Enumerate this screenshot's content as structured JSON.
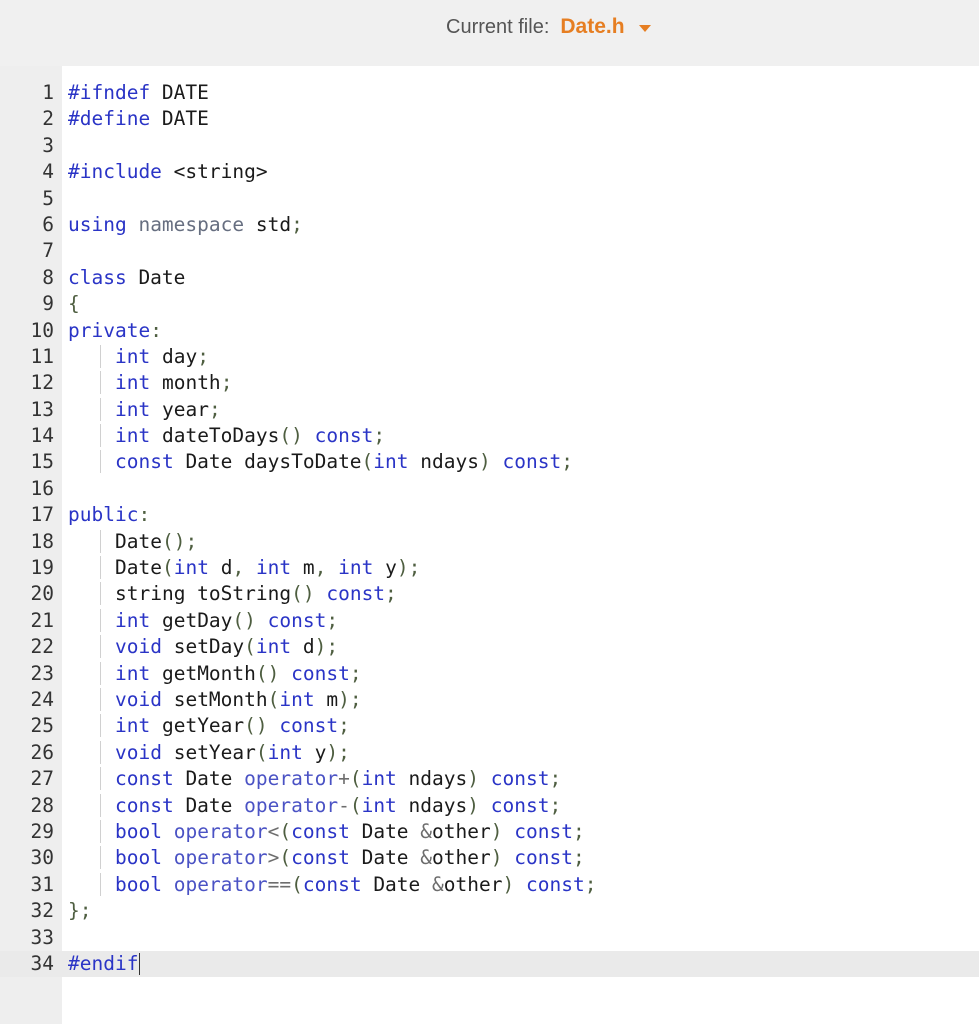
{
  "header": {
    "label": "Current file:",
    "file_name": "Date.h"
  },
  "lines": [
    [
      [
        "pp",
        "#ifndef"
      ],
      [
        "t",
        " DATE"
      ]
    ],
    [
      [
        "pp",
        "#define"
      ],
      [
        "t",
        " DATE"
      ]
    ],
    [],
    [
      [
        "pp",
        "#include"
      ],
      [
        "t",
        " <string>"
      ]
    ],
    [],
    [
      [
        "kw",
        "using"
      ],
      [
        "t",
        " "
      ],
      [
        "ns",
        "namespace"
      ],
      [
        "t",
        " std"
      ],
      [
        "p",
        ";"
      ]
    ],
    [],
    [
      [
        "kw",
        "class"
      ],
      [
        "t",
        " Date"
      ]
    ],
    [
      [
        "p",
        "{"
      ]
    ],
    [
      [
        "kw",
        "private"
      ],
      [
        "p",
        ":"
      ]
    ],
    [
      [
        "in",
        ""
      ],
      [
        "kw",
        "int"
      ],
      [
        "t",
        " day"
      ],
      [
        "p",
        ";"
      ]
    ],
    [
      [
        "in",
        ""
      ],
      [
        "kw",
        "int"
      ],
      [
        "t",
        " month"
      ],
      [
        "p",
        ";"
      ]
    ],
    [
      [
        "in",
        ""
      ],
      [
        "kw",
        "int"
      ],
      [
        "t",
        " year"
      ],
      [
        "p",
        ";"
      ]
    ],
    [
      [
        "in",
        ""
      ],
      [
        "kw",
        "int"
      ],
      [
        "t",
        " dateToDays"
      ],
      [
        "p",
        "()"
      ],
      [
        "t",
        " "
      ],
      [
        "kw",
        "const"
      ],
      [
        "p",
        ";"
      ]
    ],
    [
      [
        "in",
        ""
      ],
      [
        "kw",
        "const"
      ],
      [
        "t",
        " Date daysToDate"
      ],
      [
        "p",
        "("
      ],
      [
        "kw",
        "int"
      ],
      [
        "t",
        " ndays"
      ],
      [
        "p",
        ")"
      ],
      [
        "t",
        " "
      ],
      [
        "kw",
        "const"
      ],
      [
        "p",
        ";"
      ]
    ],
    [],
    [
      [
        "kw",
        "public"
      ],
      [
        "p",
        ":"
      ]
    ],
    [
      [
        "in",
        ""
      ],
      [
        "t",
        "Date"
      ],
      [
        "p",
        "();"
      ]
    ],
    [
      [
        "in",
        ""
      ],
      [
        "t",
        "Date"
      ],
      [
        "p",
        "("
      ],
      [
        "kw",
        "int"
      ],
      [
        "t",
        " d"
      ],
      [
        "p",
        ","
      ],
      [
        "t",
        " "
      ],
      [
        "kw",
        "int"
      ],
      [
        "t",
        " m"
      ],
      [
        "p",
        ","
      ],
      [
        "t",
        " "
      ],
      [
        "kw",
        "int"
      ],
      [
        "t",
        " y"
      ],
      [
        "p",
        ");"
      ]
    ],
    [
      [
        "in",
        ""
      ],
      [
        "t",
        "string toString"
      ],
      [
        "p",
        "()"
      ],
      [
        "t",
        " "
      ],
      [
        "kw",
        "const"
      ],
      [
        "p",
        ";"
      ]
    ],
    [
      [
        "in",
        ""
      ],
      [
        "kw",
        "int"
      ],
      [
        "t",
        " getDay"
      ],
      [
        "p",
        "()"
      ],
      [
        "t",
        " "
      ],
      [
        "kw",
        "const"
      ],
      [
        "p",
        ";"
      ]
    ],
    [
      [
        "in",
        ""
      ],
      [
        "kw",
        "void"
      ],
      [
        "t",
        " setDay"
      ],
      [
        "p",
        "("
      ],
      [
        "kw",
        "int"
      ],
      [
        "t",
        " d"
      ],
      [
        "p",
        ");"
      ]
    ],
    [
      [
        "in",
        ""
      ],
      [
        "kw",
        "int"
      ],
      [
        "t",
        " getMonth"
      ],
      [
        "p",
        "()"
      ],
      [
        "t",
        " "
      ],
      [
        "kw",
        "const"
      ],
      [
        "p",
        ";"
      ]
    ],
    [
      [
        "in",
        ""
      ],
      [
        "kw",
        "void"
      ],
      [
        "t",
        " setMonth"
      ],
      [
        "p",
        "("
      ],
      [
        "kw",
        "int"
      ],
      [
        "t",
        " m"
      ],
      [
        "p",
        ");"
      ]
    ],
    [
      [
        "in",
        ""
      ],
      [
        "kw",
        "int"
      ],
      [
        "t",
        " getYear"
      ],
      [
        "p",
        "()"
      ],
      [
        "t",
        " "
      ],
      [
        "kw",
        "const"
      ],
      [
        "p",
        ";"
      ]
    ],
    [
      [
        "in",
        ""
      ],
      [
        "kw",
        "void"
      ],
      [
        "t",
        " setYear"
      ],
      [
        "p",
        "("
      ],
      [
        "kw",
        "int"
      ],
      [
        "t",
        " y"
      ],
      [
        "p",
        ");"
      ]
    ],
    [
      [
        "in",
        ""
      ],
      [
        "kw",
        "const"
      ],
      [
        "t",
        " Date "
      ],
      [
        "kw2",
        "operator"
      ],
      [
        "op",
        "+"
      ],
      [
        "p",
        "("
      ],
      [
        "kw",
        "int"
      ],
      [
        "t",
        " ndays"
      ],
      [
        "p",
        ")"
      ],
      [
        "t",
        " "
      ],
      [
        "kw",
        "const"
      ],
      [
        "p",
        ";"
      ]
    ],
    [
      [
        "in",
        ""
      ],
      [
        "kw",
        "const"
      ],
      [
        "t",
        " Date "
      ],
      [
        "kw2",
        "operator"
      ],
      [
        "op",
        "-"
      ],
      [
        "p",
        "("
      ],
      [
        "kw",
        "int"
      ],
      [
        "t",
        " ndays"
      ],
      [
        "p",
        ")"
      ],
      [
        "t",
        " "
      ],
      [
        "kw",
        "const"
      ],
      [
        "p",
        ";"
      ]
    ],
    [
      [
        "in",
        ""
      ],
      [
        "kw",
        "bool"
      ],
      [
        "t",
        " "
      ],
      [
        "kw2",
        "operator"
      ],
      [
        "op",
        "<"
      ],
      [
        "p",
        "("
      ],
      [
        "kw",
        "const"
      ],
      [
        "t",
        " Date "
      ],
      [
        "op",
        "&"
      ],
      [
        "t",
        "other"
      ],
      [
        "p",
        ")"
      ],
      [
        "t",
        " "
      ],
      [
        "kw",
        "const"
      ],
      [
        "p",
        ";"
      ]
    ],
    [
      [
        "in",
        ""
      ],
      [
        "kw",
        "bool"
      ],
      [
        "t",
        " "
      ],
      [
        "kw2",
        "operator"
      ],
      [
        "op",
        ">"
      ],
      [
        "p",
        "("
      ],
      [
        "kw",
        "const"
      ],
      [
        "t",
        " Date "
      ],
      [
        "op",
        "&"
      ],
      [
        "t",
        "other"
      ],
      [
        "p",
        ")"
      ],
      [
        "t",
        " "
      ],
      [
        "kw",
        "const"
      ],
      [
        "p",
        ";"
      ]
    ],
    [
      [
        "in",
        ""
      ],
      [
        "kw",
        "bool"
      ],
      [
        "t",
        " "
      ],
      [
        "kw2",
        "operator"
      ],
      [
        "op",
        "=="
      ],
      [
        "p",
        "("
      ],
      [
        "kw",
        "const"
      ],
      [
        "t",
        " Date "
      ],
      [
        "op",
        "&"
      ],
      [
        "t",
        "other"
      ],
      [
        "p",
        ")"
      ],
      [
        "t",
        " "
      ],
      [
        "kw",
        "const"
      ],
      [
        "p",
        ";"
      ]
    ],
    [
      [
        "p",
        "};"
      ]
    ],
    [],
    [
      [
        "pp",
        "#endif"
      ]
    ]
  ],
  "active_line": 34
}
